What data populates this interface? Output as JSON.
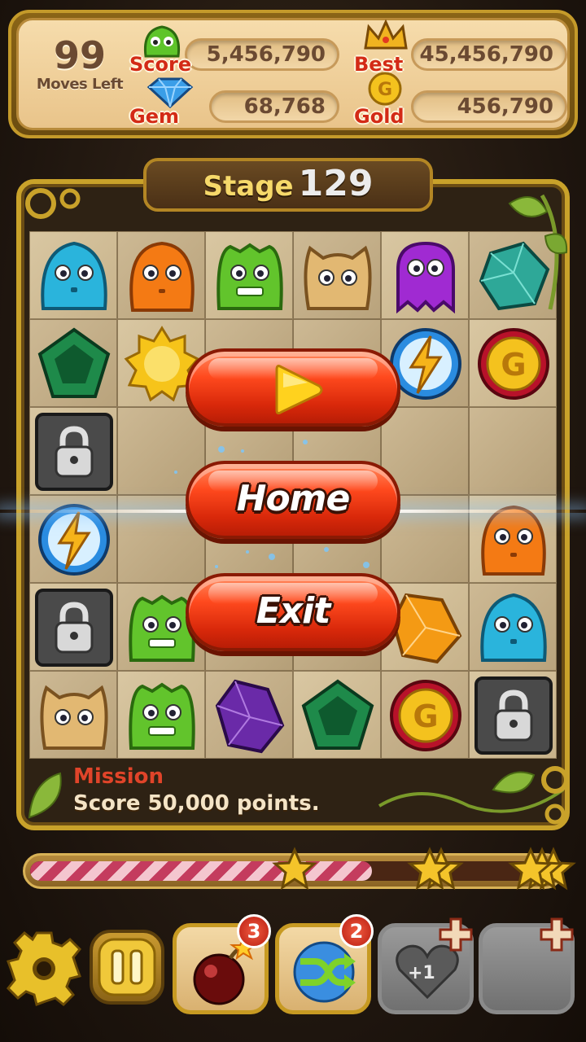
{
  "hud": {
    "moves_left": "99",
    "moves_label": "Moves Left",
    "score_label": "Score",
    "score_value": "5,456,790",
    "best_label": "Best",
    "best_value": "45,456,790",
    "gem_label": "Gem",
    "gem_value": "68,768",
    "gold_label": "Gold",
    "gold_value": "456,790"
  },
  "stage": {
    "label": "Stage",
    "number": "129"
  },
  "mission": {
    "title": "Mission",
    "text": "Score 50,000 points."
  },
  "progress": {
    "fraction": 0.65,
    "stars": 3
  },
  "menu": {
    "play_icon": "play-icon",
    "home_label": "Home",
    "exit_label": "Exit"
  },
  "boosters": {
    "bomb_count": "3",
    "shuffle_count": "2",
    "heart_label": "+1"
  },
  "board": {
    "rows": [
      [
        "blue-blob",
        "orange-blob",
        "green-blob",
        "tan-cat",
        "purple-ghost",
        "teal-gem"
      ],
      [
        "green-pentagon",
        "sun-gem",
        "",
        "",
        "lightning-orb",
        "gold-coin"
      ],
      [
        "lock-block",
        "",
        "",
        "",
        "",
        ""
      ],
      [
        "lightning-orb",
        "",
        "",
        "",
        "",
        "orange-blob"
      ],
      [
        "lock-block",
        "green-blob",
        "",
        "",
        "amber-gem",
        "blue-blob"
      ],
      [
        "tan-cat",
        "green-blob",
        "purple-crystal",
        "green-pentagon",
        "gold-coin",
        "lock-block"
      ]
    ]
  },
  "colors": {
    "button_red": "#e8340e",
    "frame_gold": "#c9a22a",
    "mission_red": "#e0442a",
    "progress_pink": "#c43c5e"
  }
}
